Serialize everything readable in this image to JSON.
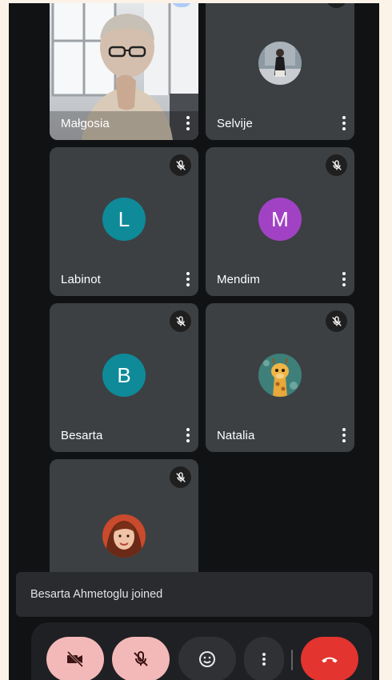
{
  "participants": [
    {
      "name": "Małgosia",
      "type": "video"
    },
    {
      "name": "Selvije",
      "type": "photo"
    },
    {
      "name": "Labinot",
      "type": "letter",
      "initial": "L",
      "color": "#0e8a99"
    },
    {
      "name": "Mendim",
      "type": "letter",
      "initial": "M",
      "color": "#a142c4"
    },
    {
      "name": "Besarta",
      "type": "letter",
      "initial": "B",
      "color": "#0e8a99"
    },
    {
      "name": "Natalia",
      "type": "photo"
    },
    {
      "name": "",
      "type": "photo"
    }
  ],
  "toast": {
    "text": "Besarta Ahmetoglu joined"
  },
  "controls": {
    "camera": {
      "icon": "videocam-off-icon",
      "color": "#f3b8b8"
    },
    "mic": {
      "icon": "mic-off-icon",
      "color": "#f3b8b8"
    },
    "reactions": {
      "icon": "emoji-icon",
      "color": "#303134"
    },
    "more": {
      "icon": "more-vert-icon",
      "color": "#303134"
    },
    "end_call": {
      "icon": "call-end-icon",
      "color": "#e3342f"
    }
  }
}
